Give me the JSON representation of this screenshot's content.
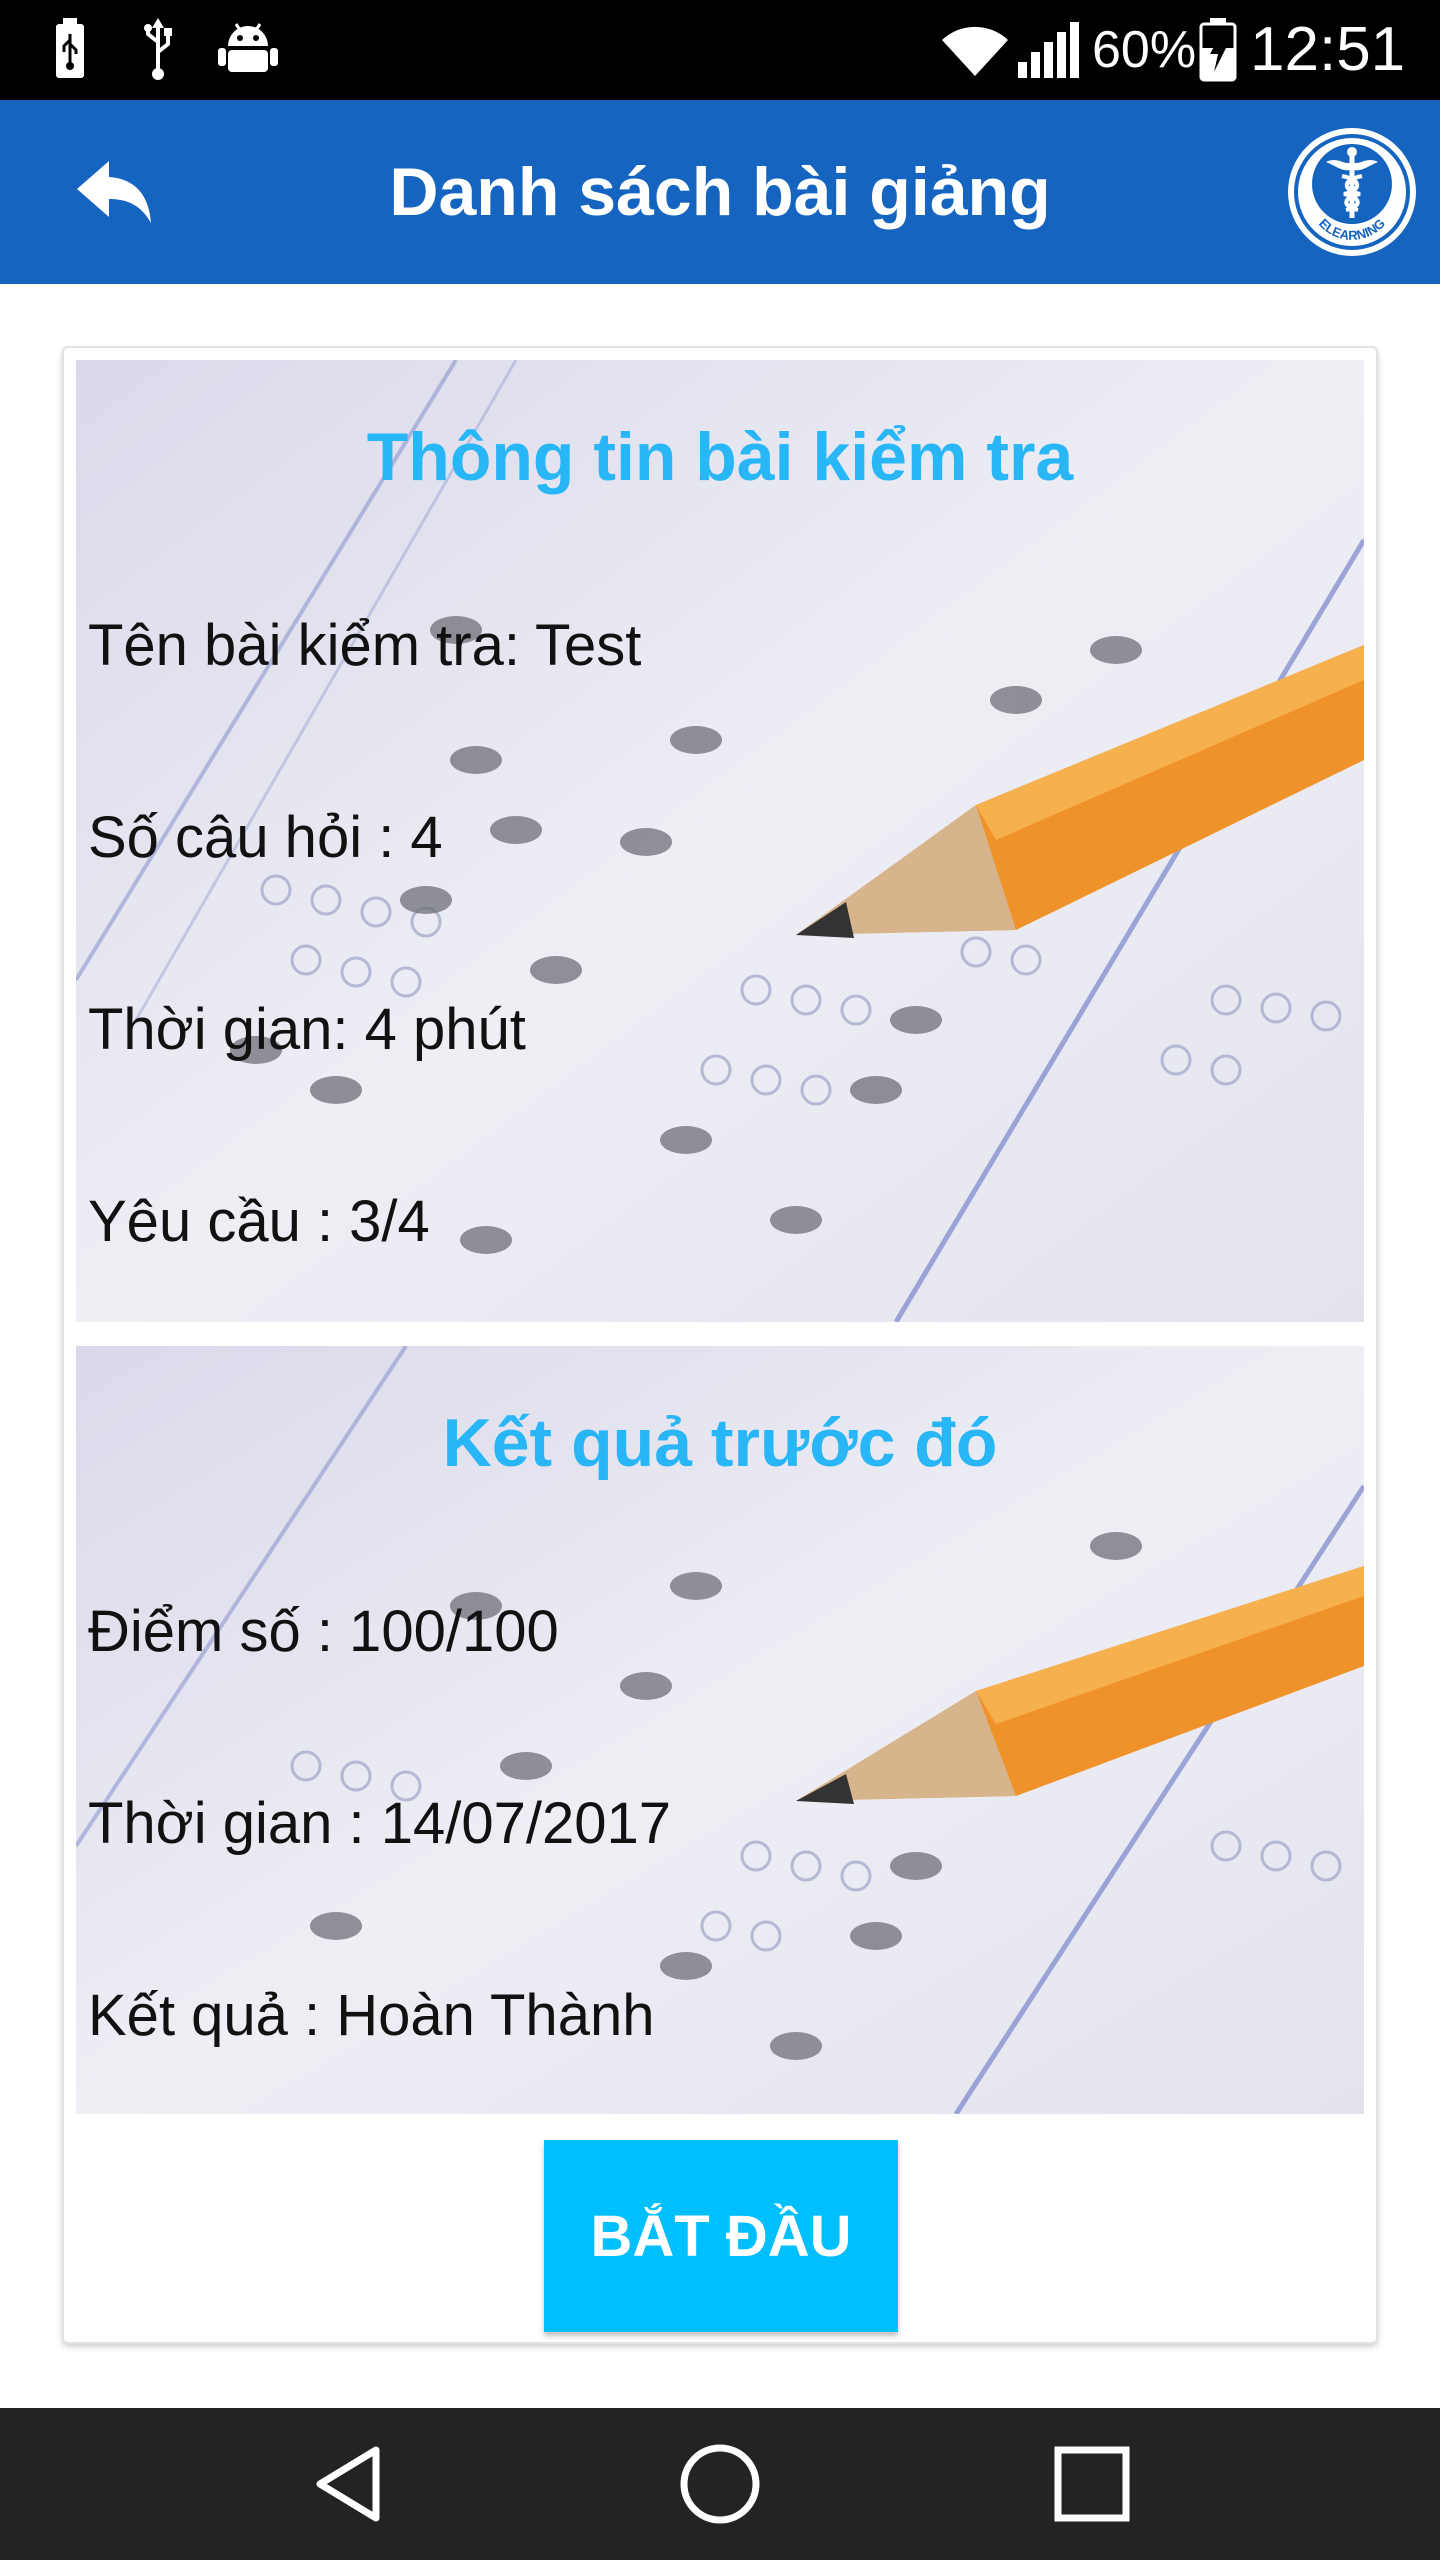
{
  "status_bar": {
    "battery_percent": "60%",
    "time": "12:51",
    "icons": [
      "usb-battery-icon",
      "usb-icon",
      "android-debug-icon",
      "wifi-icon",
      "signal-icon",
      "battery-charging-icon"
    ]
  },
  "app_bar": {
    "title": "Danh sách bài giảng",
    "back_icon": "reply-back-icon",
    "logo_text": "ELEARNING",
    "logo_icon": "caduceus-icon"
  },
  "test_info": {
    "heading": "Thông tin bài kiểm tra",
    "name_line": "Tên bài kiểm tra: Test",
    "question_count_line": "Số câu hỏi : 4",
    "duration_line": "Thời gian: 4 phút",
    "requirement_line": "Yêu cầu : 3/4"
  },
  "previous_result": {
    "heading": "Kết quả trước đó",
    "score_line": "Điểm số : 100/100",
    "date_line": "Thời gian : 14/07/2017",
    "result_line": "Kết quả : Hoàn Thành"
  },
  "actions": {
    "start_label": "BẮT ĐẦU"
  },
  "colors": {
    "app_bar": "#1565c0",
    "heading": "#29b6f6",
    "start_button": "#00bfff",
    "nav_bar": "#232323"
  },
  "nav_bar": {
    "icons": [
      "back-triangle-icon",
      "home-circle-icon",
      "recents-square-icon"
    ]
  }
}
